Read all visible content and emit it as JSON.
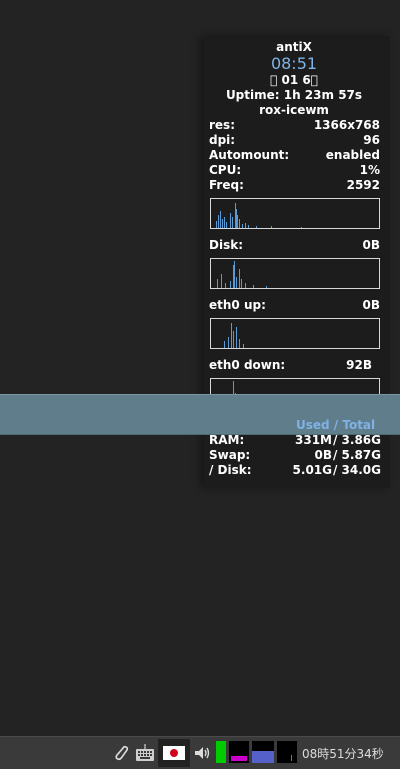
{
  "conky": {
    "distro": "antiX",
    "time": "08:51",
    "date": "\u0000 01  6\u0000",
    "uptime": "Uptime: 1h 23m 57s",
    "wm": "rox-icewm",
    "stats": [
      {
        "key": "res:",
        "value": "1366x768"
      },
      {
        "key": "dpi:",
        "value": "96"
      },
      {
        "key": "Automount:",
        "value": "enabled"
      },
      {
        "key": "CPU:",
        "value": "1%"
      },
      {
        "key": "Freq:",
        "value": "2592"
      }
    ],
    "disk": {
      "key": "Disk:",
      "value": "0B"
    },
    "eth0_up": {
      "key": "eth0 up:",
      "value": "0B"
    },
    "eth0_down": {
      "key": "eth0 down:",
      "value": "92B"
    },
    "used_total_label": "Used / Total",
    "memory": [
      {
        "key": "RAM:",
        "used": "331M",
        "total": "/ 3.86G"
      },
      {
        "key": "Swap:",
        "used": "0B",
        "total": "/ 5.87G"
      },
      {
        "key": "/ Disk:",
        "used": "5.01G",
        "total": "/ 34.0G"
      }
    ],
    "graph_color": "#5b9bd5",
    "label_color": "#7fb2e5"
  },
  "taskbar": {
    "clock": "08時51分34秒",
    "tray_icons": [
      "paperclip-icon",
      "keyboard-icon",
      "japan-flag-icon",
      "volume-icon",
      "cpu-monitor-icon",
      "network-monitor-icon",
      "memory-monitor-icon",
      "disk-monitor-icon"
    ]
  }
}
